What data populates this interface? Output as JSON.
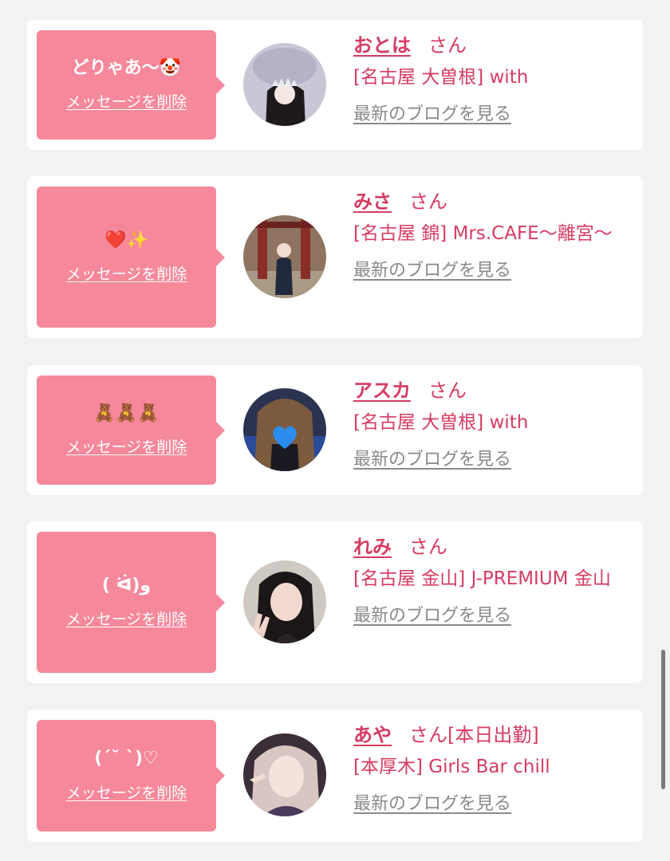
{
  "colors": {
    "background": "#f2f2f2",
    "card": "#ffffff",
    "bubble": "#f6889b",
    "accent_text": "#d63c62",
    "link_gray": "#8a8a8a"
  },
  "messages": [
    {
      "message": "どりゃあ〜🤡",
      "delete_label": "メッセージを削除",
      "name": "おとは",
      "honorific": "さん",
      "shop": "[名古屋 大曽根] with",
      "blog_label": "最新のブログを見る"
    },
    {
      "message": "❤️✨",
      "delete_label": "メッセージを削除",
      "name": "みさ",
      "honorific": "さん",
      "shop": "[名古屋 錦] Mrs.CAFE〜離宮〜",
      "blog_label": "最新のブログを見る"
    },
    {
      "message": "🧸🧸🧸",
      "delete_label": "メッセージを削除",
      "name": "アスカ",
      "honorific": "さん",
      "shop": "[名古屋 大曽根] with",
      "blog_label": "最新のブログを見る"
    },
    {
      "message": "( ᐛ)و",
      "delete_label": "メッセージを削除",
      "name": "れみ",
      "honorific": "さん",
      "shop": "[名古屋 金山] J-PREMIUM 金山",
      "blog_label": "最新のブログを見る"
    },
    {
      "message": "(ˊ˘ ˋ)♡",
      "delete_label": "メッセージを削除",
      "name": "あや",
      "honorific": "さん[本日出勤]",
      "shop": "[本厚木] Girls Bar chill",
      "blog_label": "最新のブログを見る"
    }
  ]
}
